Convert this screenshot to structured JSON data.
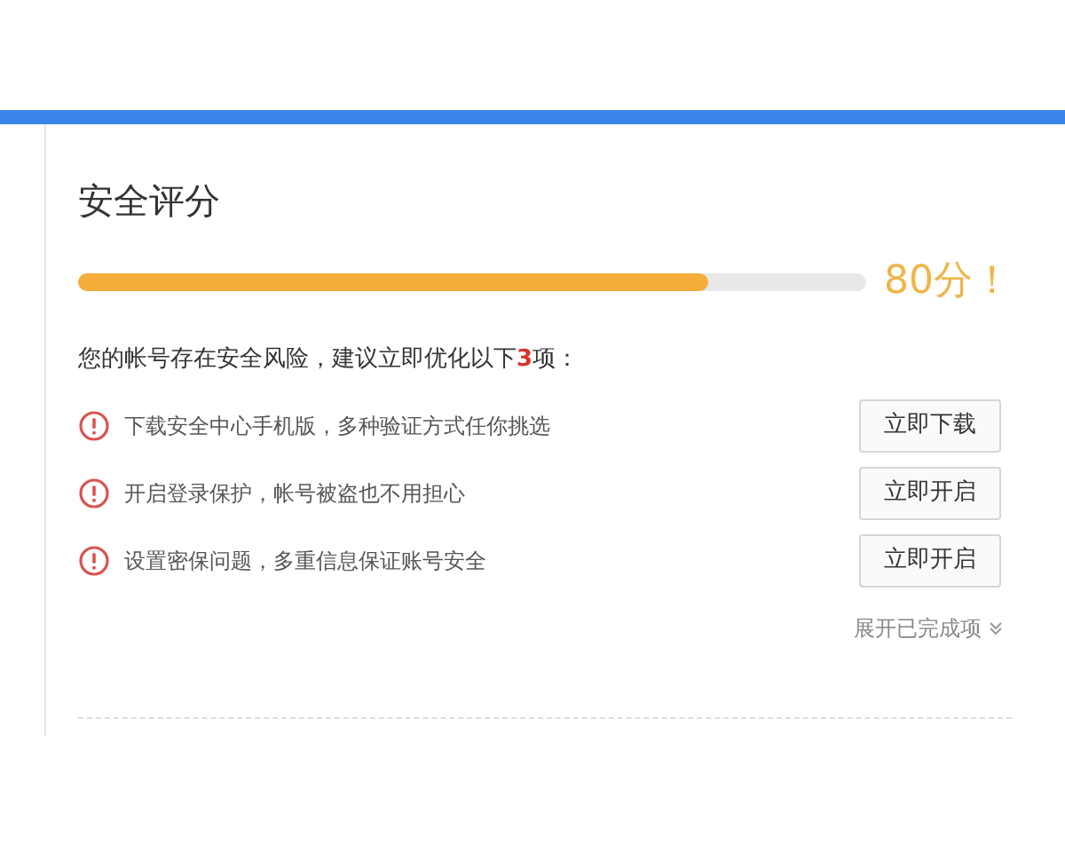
{
  "title": "安全评分",
  "score": {
    "level": 0.8,
    "reading": "80分！"
  },
  "notice": "您的帐号存在安全风险，建议立即优化以下**3**项：",
  "items": [
    {
      "text": "下载安全中心手机版，多种验证方式任你挑选",
      "button": "立即下载"
    },
    {
      "text": "开启登录保护，帐号被盗也不用担心",
      "button": "立即开启"
    },
    {
      "text": "设置密保问题，多重信息保证账号安全",
      "button": "立即开启"
    }
  ],
  "expand": {
    "label": "展开已完成项",
    "expanded": false
  }
}
